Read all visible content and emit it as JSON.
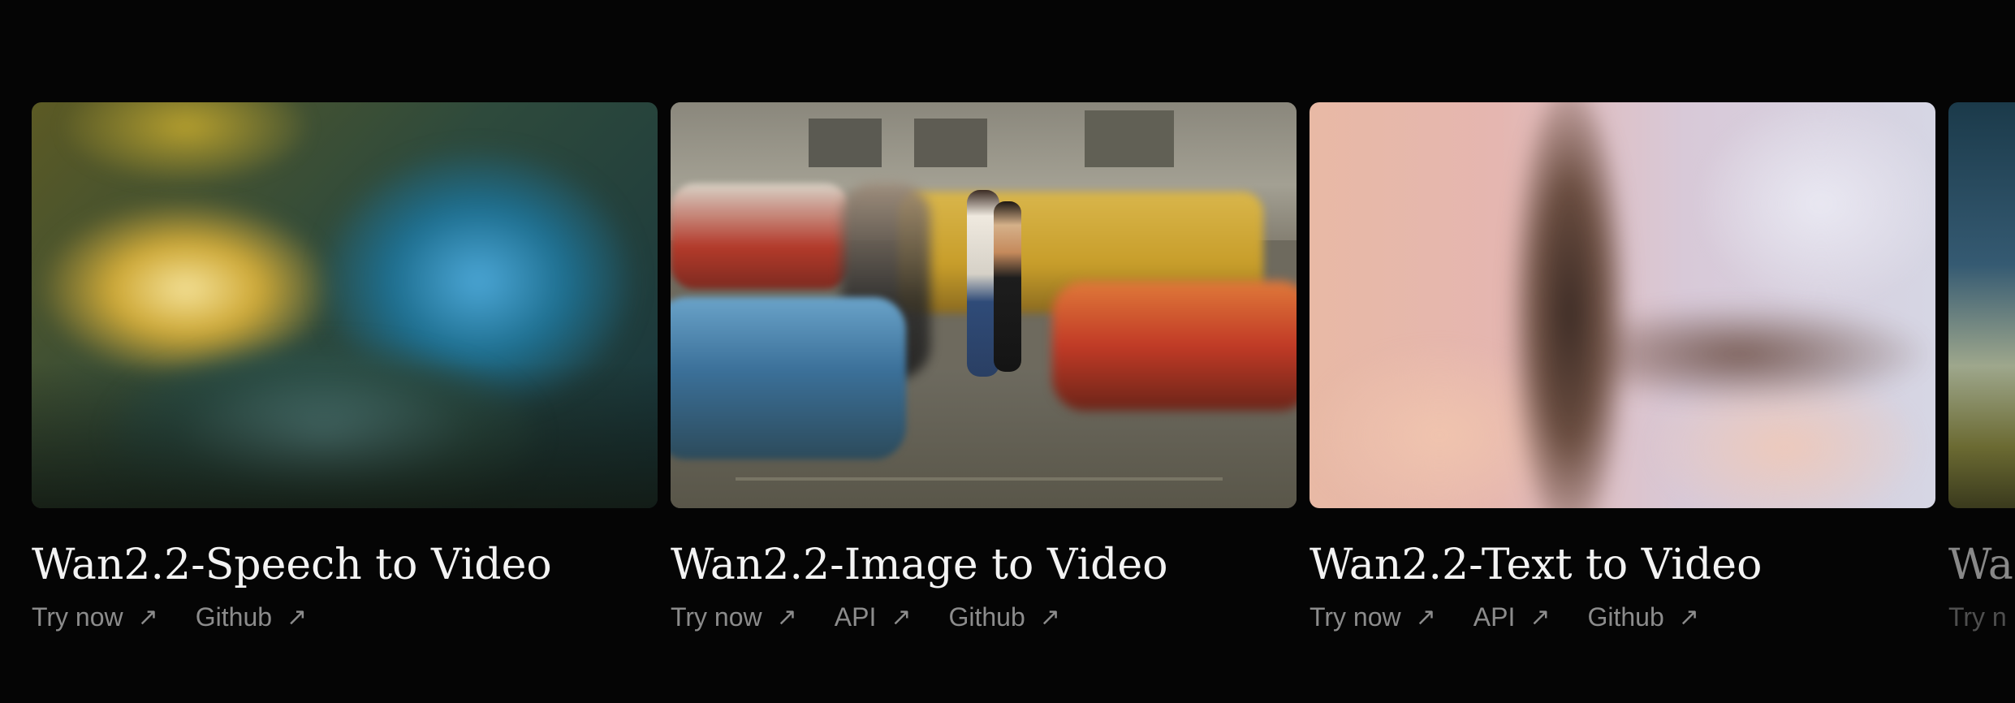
{
  "cards": [
    {
      "title": "Wan2.2-Speech to Video",
      "links": [
        {
          "label": "Try now",
          "icon": "arrow-up-right-icon"
        },
        {
          "label": "Github",
          "icon": "arrow-up-right-icon"
        }
      ]
    },
    {
      "title": "Wan2.2-Image to Video",
      "links": [
        {
          "label": "Try now",
          "icon": "arrow-up-right-icon"
        },
        {
          "label": "API",
          "icon": "arrow-up-right-icon"
        },
        {
          "label": "Github",
          "icon": "arrow-up-right-icon"
        }
      ]
    },
    {
      "title": "Wan2.2-Text to Video",
      "links": [
        {
          "label": "Try now",
          "icon": "arrow-up-right-icon"
        },
        {
          "label": "API",
          "icon": "arrow-up-right-icon"
        },
        {
          "label": "Github",
          "icon": "arrow-up-right-icon"
        }
      ]
    },
    {
      "title": "Wa",
      "links": [
        {
          "label": "Try n",
          "icon": "arrow-up-right-icon"
        }
      ]
    }
  ],
  "colors": {
    "background": "#050505",
    "title": "#f3f3f3",
    "link": "#8c8c8c"
  },
  "arrow_glyph": "↗"
}
